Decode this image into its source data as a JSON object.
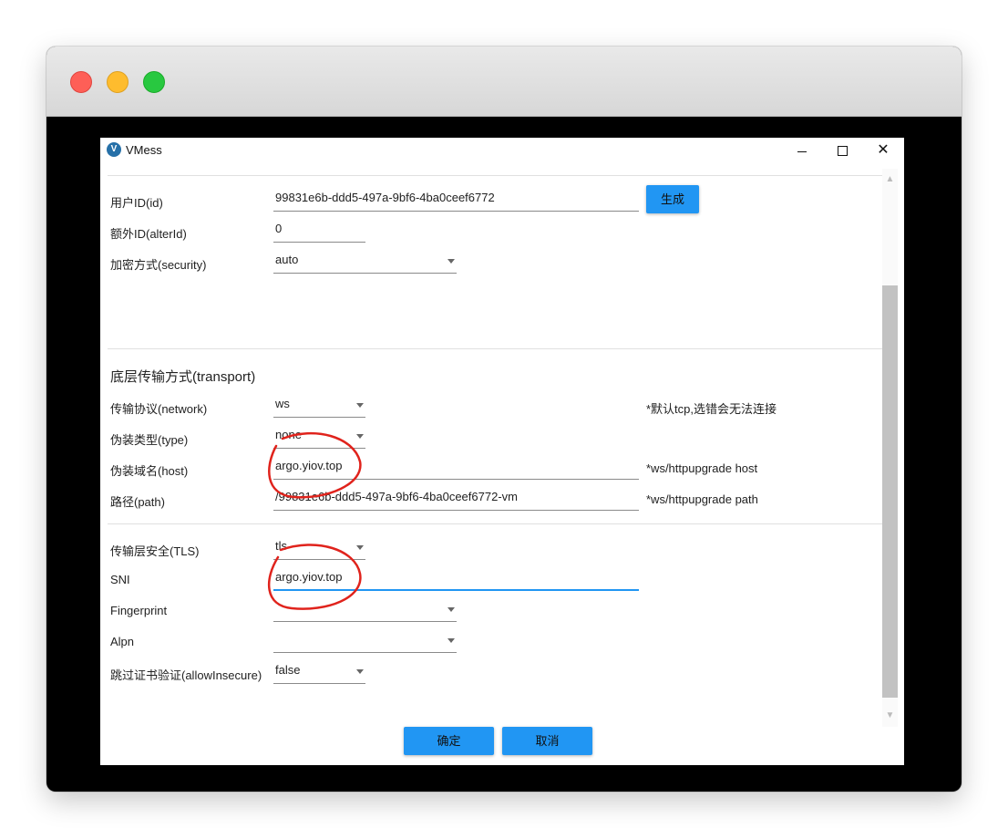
{
  "dialog": {
    "title": "VMess",
    "app_icon_glyph": "V",
    "controls": {
      "minimize": "minimize-icon",
      "maximize": "maximize-icon",
      "close": "✕"
    }
  },
  "account": {
    "user_id_label": "用户ID(id)",
    "user_id_value": "99831e6b-ddd5-497a-9bf6-4ba0ceef6772",
    "generate_label": "生成",
    "alter_id_label": "额外ID(alterId)",
    "alter_id_value": "0",
    "security_label": "加密方式(security)",
    "security_value": "auto"
  },
  "transport": {
    "section_title": "底层传输方式(transport)",
    "network_label": "传输协议(network)",
    "network_value": "ws",
    "network_hint": "*默认tcp,选错会无法连接",
    "type_label": "伪装类型(type)",
    "type_value": "none",
    "host_label": "伪装域名(host)",
    "host_value": "argo.yiov.top",
    "host_hint": "*ws/httpupgrade host",
    "path_label": "路径(path)",
    "path_value": "/99831e6b-ddd5-497a-9bf6-4ba0ceef6772-vm",
    "path_hint": "*ws/httpupgrade path"
  },
  "tls": {
    "tls_label": "传输层安全(TLS)",
    "tls_value": "tls",
    "sni_label": "SNI",
    "sni_value": "argo.yiov.top",
    "fingerprint_label": "Fingerprint",
    "fingerprint_value": "",
    "alpn_label": "Alpn",
    "alpn_value": "",
    "allow_insecure_label": "跳过证书验证(allowInsecure)",
    "allow_insecure_value": "false"
  },
  "footer": {
    "ok_label": "确定",
    "cancel_label": "取消"
  },
  "colors": {
    "accent": "#2196f3",
    "annotation": "#e0231c",
    "traffic_red": "#fe5f57",
    "traffic_yellow": "#febc2e",
    "traffic_green": "#28c840"
  }
}
